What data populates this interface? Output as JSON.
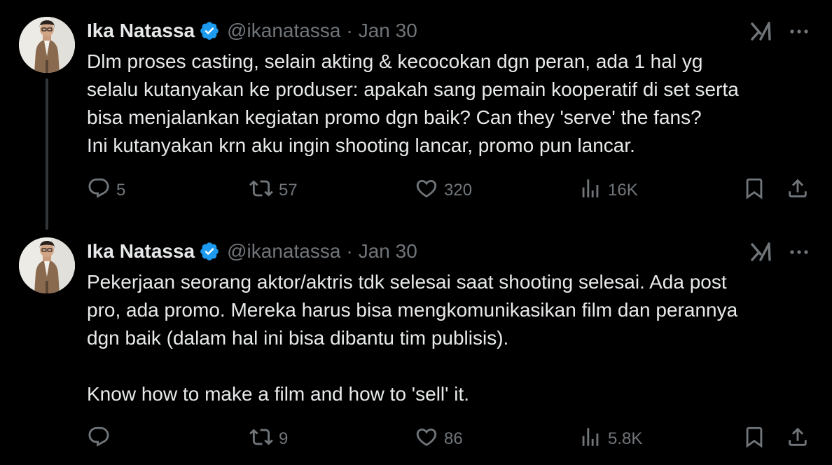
{
  "tweets": [
    {
      "author": {
        "display_name": "Ika Natassa",
        "handle": "@ikanatassa",
        "verified": true
      },
      "separator": "·",
      "date": "Jan 30",
      "lines": [
        "Dlm proses casting, selain akting & kecocokan dgn peran, ada 1 hal yg",
        "selalu kutanyakan ke produser: apakah sang pemain kooperatif di set serta",
        "bisa menjalankan kegiatan promo dgn baik? Can they 'serve' the fans?",
        "Ini kutanyakan krn aku ingin shooting lancar, promo pun lancar."
      ],
      "stats": {
        "replies": "5",
        "reposts": "57",
        "likes": "320",
        "views": "16K"
      }
    },
    {
      "author": {
        "display_name": "Ika Natassa",
        "handle": "@ikanatassa",
        "verified": true
      },
      "separator": "·",
      "date": "Jan 30",
      "lines": [
        "Pekerjaan seorang aktor/aktris tdk selesai saat shooting selesai. Ada post",
        "pro, ada promo. Mereka harus bisa mengkomunikasikan film dan perannya",
        "dgn baik (dalam hal ini bisa dibantu tim publisis).",
        "",
        "Know how to make a film and how to 'sell' it."
      ],
      "stats": {
        "replies": "",
        "reposts": "9",
        "likes": "86",
        "views": "5.8K"
      }
    }
  ],
  "icons": {
    "verified": "verified-badge-icon",
    "grok": "grok-icon",
    "more": "more-options-icon",
    "reply": "reply-icon",
    "repost": "repost-icon",
    "like": "heart-icon",
    "views": "views-icon",
    "bookmark": "bookmark-icon",
    "share": "share-icon"
  },
  "colors": {
    "background": "#000000",
    "text_primary": "#e7e9ea",
    "text_secondary": "#71767b",
    "verified_blue": "#1d9bf0",
    "thread_line": "#333639"
  }
}
